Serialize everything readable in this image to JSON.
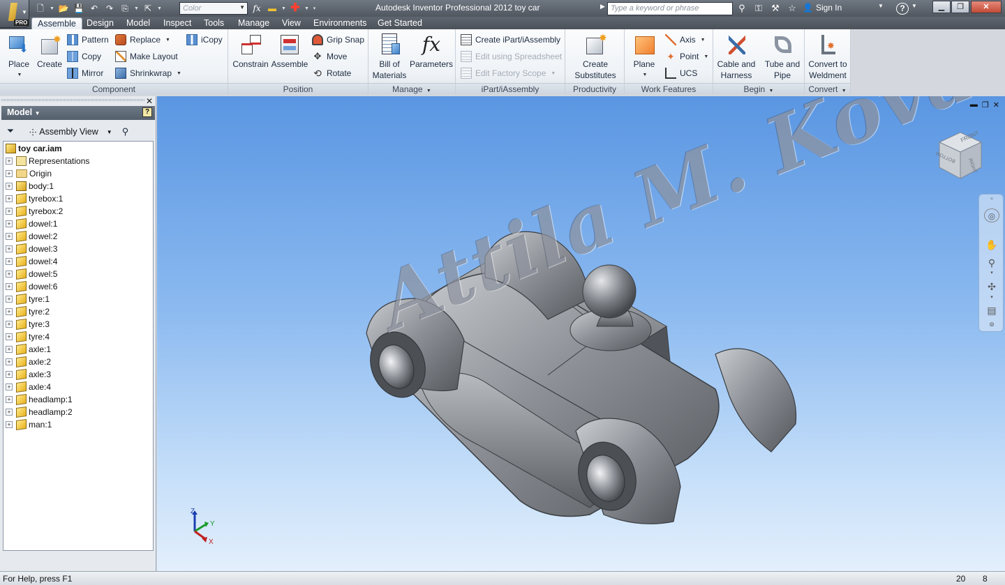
{
  "titlebar": {
    "app_title": "Autodesk Inventor Professional 2012    toy car",
    "color_placeholder": "Color",
    "search_placeholder": "Type a keyword or phrase",
    "sign_in": "Sign In",
    "help": "?",
    "pro_badge": "PRO"
  },
  "tabs": [
    "Assemble",
    "Design",
    "Model",
    "Inspect",
    "Tools",
    "Manage",
    "View",
    "Environments",
    "Get Started"
  ],
  "ribbon": {
    "component": {
      "title": "Component",
      "place": "Place",
      "create": "Create",
      "pattern": "Pattern",
      "copy": "Copy",
      "mirror": "Mirror",
      "replace": "Replace",
      "make_layout": "Make Layout",
      "shrinkwrap": "Shrinkwrap",
      "icopy": "iCopy"
    },
    "position": {
      "title": "Position",
      "constrain": "Constrain",
      "assemble": "Assemble",
      "grip_snap": "Grip Snap",
      "move": "Move",
      "rotate": "Rotate"
    },
    "manage": {
      "title": "Manage",
      "bom_line1": "Bill of",
      "bom_line2": "Materials",
      "parameters": "Parameters"
    },
    "ipart": {
      "title": "iPart/iAssembly",
      "create": "Create iPart/iAssembly",
      "edit_spreadsheet": "Edit using Spreadsheet",
      "edit_factory": "Edit Factory Scope"
    },
    "productivity": {
      "title": "Productivity",
      "line1": "Create",
      "line2": "Substitutes"
    },
    "work_features": {
      "title": "Work Features",
      "plane": "Plane",
      "axis": "Axis",
      "point": "Point",
      "ucs": "UCS"
    },
    "begin": {
      "title": "Begin",
      "cable_line1": "Cable and",
      "cable_line2": "Harness",
      "tube_line1": "Tube and",
      "tube_line2": "Pipe"
    },
    "convert": {
      "title": "Convert",
      "line1": "Convert to",
      "line2": "Weldment"
    }
  },
  "browser": {
    "header": "Model",
    "view": "Assembly View",
    "help": "?",
    "root": "toy car.iam",
    "nodes": [
      {
        "label": "Representations",
        "kind": "rep"
      },
      {
        "label": "Origin",
        "kind": "folder"
      },
      {
        "label": "body:1",
        "kind": "asm"
      },
      {
        "label": "tyrebox:1",
        "kind": "part"
      },
      {
        "label": "tyrebox:2",
        "kind": "part"
      },
      {
        "label": "dowel:1",
        "kind": "part"
      },
      {
        "label": "dowel:2",
        "kind": "part"
      },
      {
        "label": "dowel:3",
        "kind": "part"
      },
      {
        "label": "dowel:4",
        "kind": "part"
      },
      {
        "label": "dowel:5",
        "kind": "part"
      },
      {
        "label": "dowel:6",
        "kind": "part"
      },
      {
        "label": "tyre:1",
        "kind": "part"
      },
      {
        "label": "tyre:2",
        "kind": "part"
      },
      {
        "label": "tyre:3",
        "kind": "part"
      },
      {
        "label": "tyre:4",
        "kind": "part"
      },
      {
        "label": "axle:1",
        "kind": "part"
      },
      {
        "label": "axle:2",
        "kind": "part"
      },
      {
        "label": "axle:3",
        "kind": "part"
      },
      {
        "label": "axle:4",
        "kind": "part"
      },
      {
        "label": "headlamp:1",
        "kind": "part"
      },
      {
        "label": "headlamp:2",
        "kind": "part"
      },
      {
        "label": "man:1",
        "kind": "part"
      }
    ]
  },
  "viewcube": {
    "front": "FRONT",
    "right": "RIGHT",
    "bottom": "BOTTOM"
  },
  "triad": {
    "x": "X",
    "y": "Y",
    "z": "Z"
  },
  "watermark": "Attila M. Kovacs",
  "status": {
    "help": "For Help, press F1",
    "count1": "20",
    "count2": "8"
  }
}
